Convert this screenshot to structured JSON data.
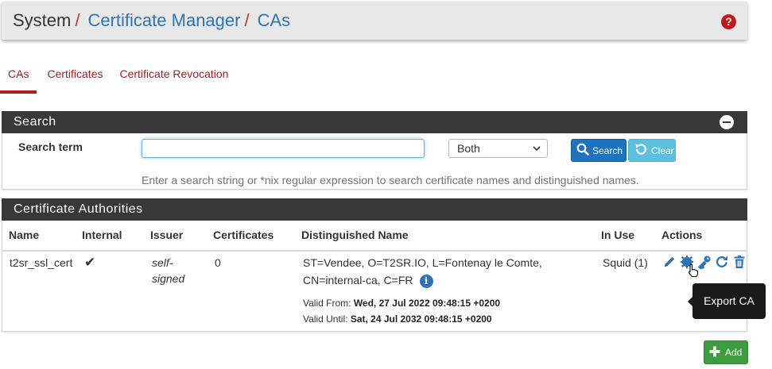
{
  "breadcrumb": {
    "system": "System",
    "sep": "/",
    "cert_manager": "Certificate Manager",
    "current": "CAs",
    "help": "?"
  },
  "tabs": [
    {
      "label": "CAs",
      "active": true
    },
    {
      "label": "Certificates",
      "active": false
    },
    {
      "label": "Certificate Revocation",
      "active": false
    }
  ],
  "search": {
    "panel_title": "Search",
    "label": "Search term",
    "input_value": "",
    "select_value": "Both",
    "search_button": "Search",
    "clear_button": "Clear",
    "help_text": "Enter a search string or *nix regular expression to search certificate names and distinguished names."
  },
  "ca_table": {
    "panel_title": "Certificate Authorities",
    "columns": [
      "Name",
      "Internal",
      "Issuer",
      "Certificates",
      "Distinguished Name",
      "In Use",
      "Actions"
    ],
    "rows": [
      {
        "name": "t2sr_ssl_cert",
        "internal": "✔",
        "issuer_line1": "self-",
        "issuer_line2": "signed",
        "certificates": "0",
        "dn_line1": "ST=Vendee, O=T2SR.IO, L=Fontenay le Comte,",
        "dn_line2": "CN=internal-ca, C=FR",
        "valid_from_label": "Valid From:",
        "valid_from": "Wed, 27 Jul 2022 09:48:15 +0200",
        "valid_until_label": "Valid Until:",
        "valid_until": "Sat, 24 Jul 2032 09:48:15 +0200",
        "in_use": "Squid (1)"
      }
    ]
  },
  "tooltip": "Export CA",
  "add_button": "Add",
  "colors": {
    "header_bg": "#383838",
    "link": "#2e74b5",
    "tab_red": "#a71d1d",
    "search_btn": "#1e73be",
    "clear_btn": "#5bc0de",
    "add_btn": "#3f9b3f"
  }
}
